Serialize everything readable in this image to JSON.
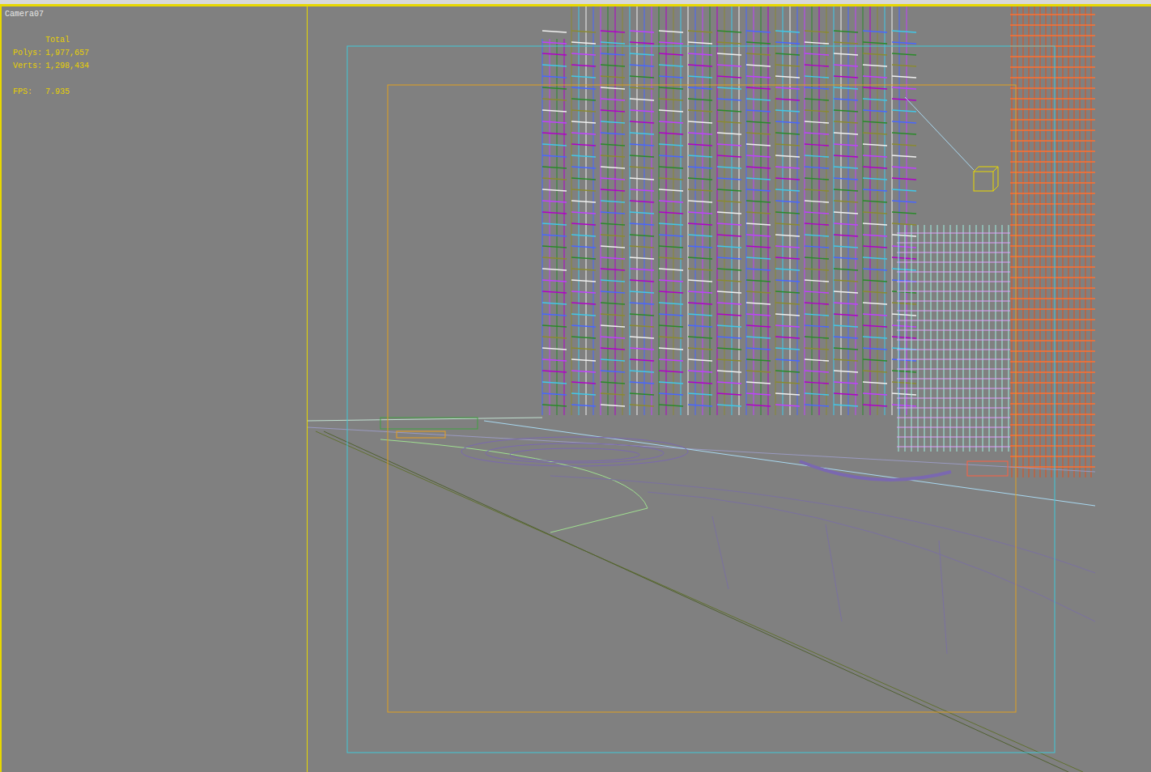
{
  "viewport": {
    "label": "Camera07"
  },
  "stats": {
    "title": "Total",
    "rows": [
      {
        "label": "Polys:",
        "value": "1,977,657"
      },
      {
        "label": "Verts:",
        "value": "1,298,434"
      }
    ],
    "fps": {
      "label": "FPS:",
      "value": "7.935"
    }
  }
}
